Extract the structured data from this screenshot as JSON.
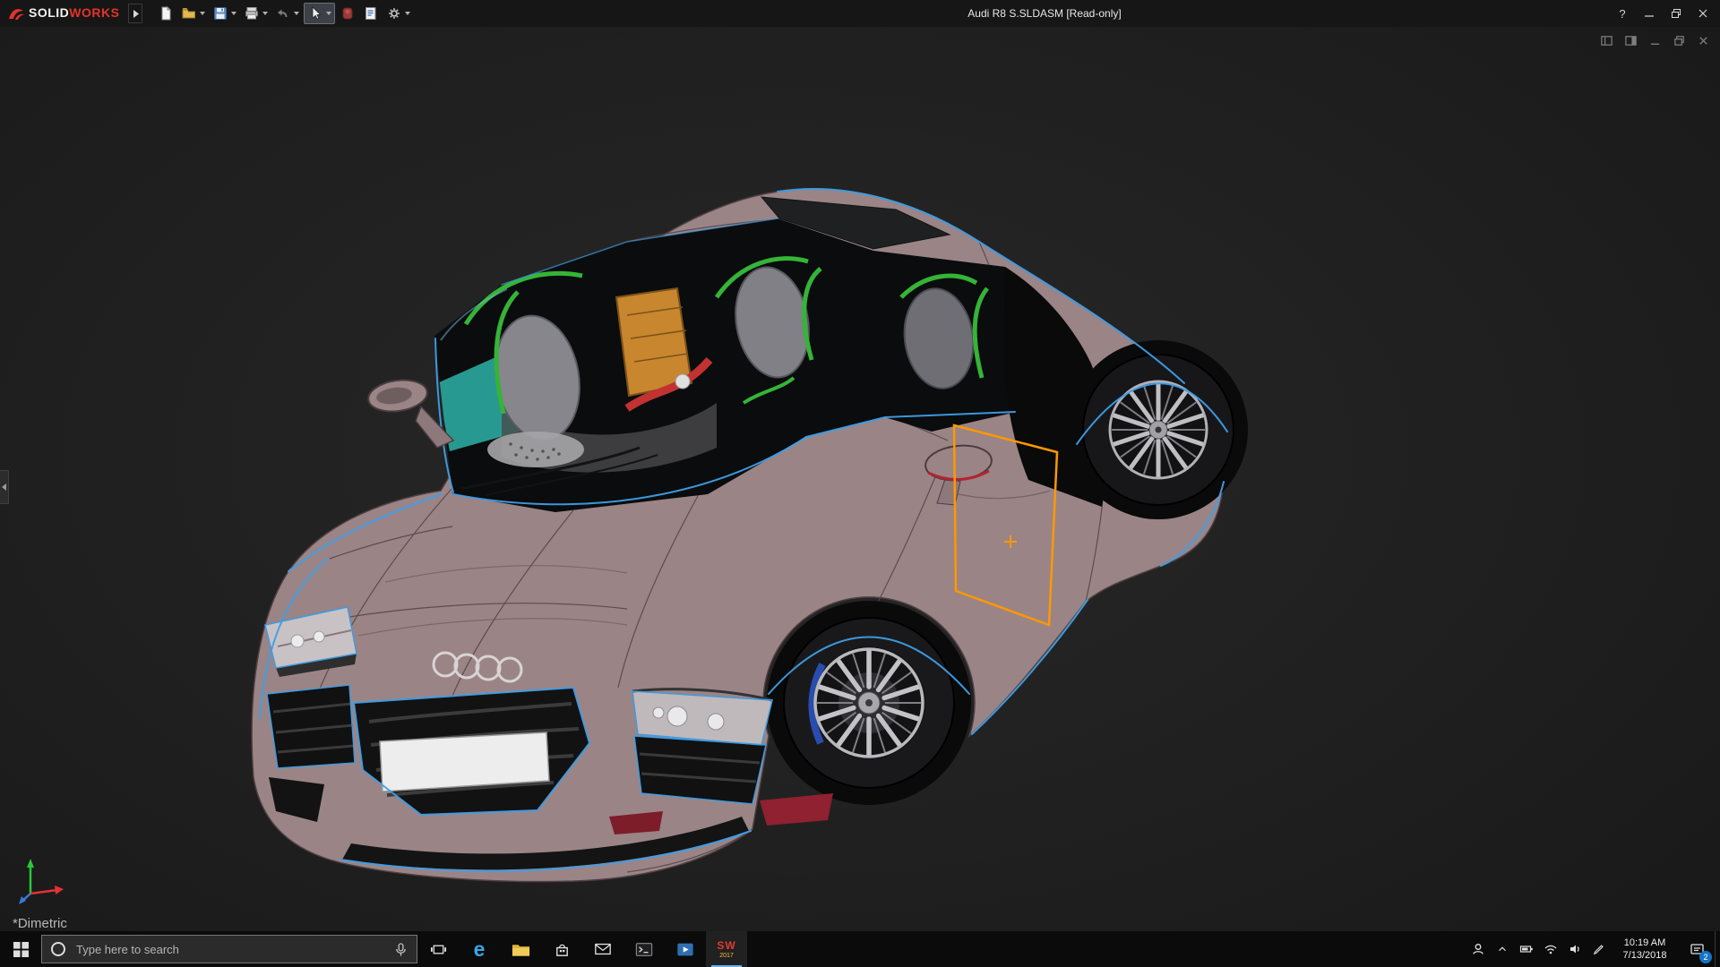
{
  "colors": {
    "accent_blue": "#3f9fe8",
    "selection_orange": "#ff9800",
    "car_body": "#9a8486",
    "viewport_bg": "#202020",
    "titlebar_bg": "#161616",
    "taskbar_bg": "#0b0b0b"
  },
  "titlebar": {
    "logo": {
      "solid": "SOLID",
      "works": "WORKS"
    },
    "title": "Audi R8 S.SLDASM [Read-only]",
    "help_label": "?",
    "toolbar_icons": [
      "new-document",
      "open",
      "save",
      "print",
      "undo",
      "select",
      "rebuild",
      "file-properties",
      "options"
    ]
  },
  "viewport": {
    "view_label": "*Dimetric"
  },
  "taskbar": {
    "search_placeholder": "Type here to search",
    "apps": [
      {
        "name": "task-view"
      },
      {
        "name": "microsoft-edge",
        "glyph": "e"
      },
      {
        "name": "file-explorer"
      },
      {
        "name": "microsoft-store"
      },
      {
        "name": "mail"
      },
      {
        "name": "terminal"
      },
      {
        "name": "media-player"
      },
      {
        "name": "solidworks-2017",
        "glyph": "SW",
        "year": "2017"
      }
    ],
    "tray_icons": [
      "people",
      "hidden-icons",
      "battery",
      "network",
      "volume",
      "pen"
    ],
    "clock": {
      "time": "10:19 AM",
      "date": "7/13/2018"
    },
    "action_center_badge": "2"
  }
}
